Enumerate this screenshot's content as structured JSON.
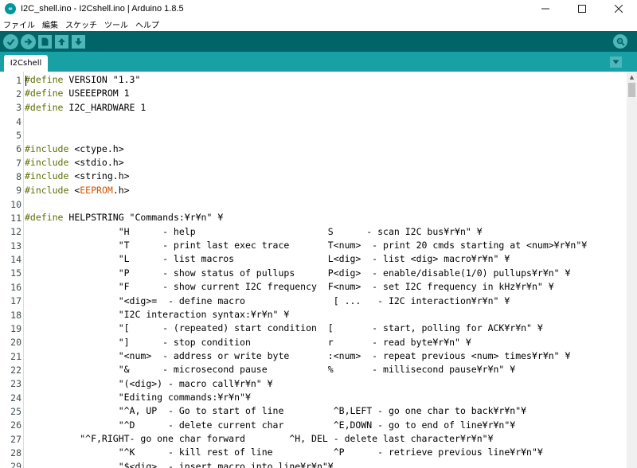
{
  "window": {
    "title": "I2C_shell.ino - I2Cshell.ino | Arduino 1.8.5",
    "app_icon": "arduino-logo-icon",
    "controls": [
      "minimize",
      "maximize",
      "close"
    ]
  },
  "menu": {
    "items": [
      "ファイル",
      "編集",
      "スケッチ",
      "ツール",
      "ヘルプ"
    ]
  },
  "toolbar": {
    "buttons": [
      "verify-icon",
      "upload-icon",
      "new-icon",
      "open-icon",
      "save-icon"
    ],
    "right_button": "serial-monitor-icon"
  },
  "tabs": {
    "active": "I2Cshell",
    "menu_icon": "tab-menu-arrow-icon"
  },
  "colors": {
    "toolbar_bg": "#006468",
    "tabbar_bg": "#17a1a5",
    "button_bg": "#4db7bb",
    "preprocessor": "#5e6d03",
    "library_keyword": "#d35400",
    "line_number": "#434f54"
  },
  "editor": {
    "line_numbers": [
      "1",
      "2",
      "3",
      "4",
      "5",
      "6",
      "7",
      "8",
      "9",
      "10",
      "11",
      "12",
      "13",
      "14",
      "15",
      "16",
      "17",
      "18",
      "19",
      "20",
      "21",
      "22",
      "23",
      "24",
      "25",
      "26",
      "27",
      "28",
      "29"
    ],
    "lines": [
      {
        "pre": "#define",
        "text": " VERSION \"1.3\""
      },
      {
        "pre": "#define",
        "text": " USEEEPROM 1"
      },
      {
        "pre": "#define",
        "text": " I2C_HARDWARE 1"
      },
      {
        "pre": "",
        "text": ""
      },
      {
        "pre": "",
        "text": ""
      },
      {
        "pre": "#include",
        "text": " <ctype.h>"
      },
      {
        "pre": "#include",
        "text": " <stdio.h>"
      },
      {
        "pre": "#include",
        "text": " <string.h>"
      },
      {
        "pre": "#include",
        "text": " <",
        "lib": "EEPROM",
        "after": ".h>"
      },
      {
        "pre": "",
        "text": ""
      },
      {
        "pre": "#define",
        "text": " HELPSTRING \"Commands:¥r¥n\" ¥"
      },
      {
        "pre": "",
        "text": "                 \"H      - help                        S      - scan I2C bus¥r¥n\" ¥"
      },
      {
        "pre": "",
        "text": "                 \"T      - print last exec trace       T<num>  - print 20 cmds starting at <num>¥r¥n\"¥"
      },
      {
        "pre": "",
        "text": "                 \"L      - list macros                 L<dig>  - list <dig> macro¥r¥n\" ¥"
      },
      {
        "pre": "",
        "text": "                 \"P      - show status of pullups      P<dig>  - enable/disable(1/0) pullups¥r¥n\" ¥"
      },
      {
        "pre": "",
        "text": "                 \"F      - show current I2C frequency  F<num>  - set I2C frequency in kHz¥r¥n\" ¥"
      },
      {
        "pre": "",
        "text": "                 \"<dig>=  - define macro                [ ...   - I2C interaction¥r¥n\" ¥"
      },
      {
        "pre": "",
        "text": "                 \"I2C interaction syntax:¥r¥n\" ¥"
      },
      {
        "pre": "",
        "text": "                 \"[      - (repeated) start condition  [       - start, polling for ACK¥r¥n\" ¥"
      },
      {
        "pre": "",
        "text": "                 \"]      - stop condition              r       - read byte¥r¥n\" ¥"
      },
      {
        "pre": "",
        "text": "                 \"<num>  - address or write byte       :<num>  - repeat previous <num> times¥r¥n\" ¥"
      },
      {
        "pre": "",
        "text": "                 \"&      - microsecond pause           %       - millisecond pause¥r¥n\" ¥"
      },
      {
        "pre": "",
        "text": "                 \"(<dig>) - macro call¥r¥n\" ¥"
      },
      {
        "pre": "",
        "text": "                 \"Editing commands:¥r¥n\"¥"
      },
      {
        "pre": "",
        "text": "                 \"^A, UP  - Go to start of line         ^B,LEFT - go one char to back¥r¥n\"¥"
      },
      {
        "pre": "",
        "text": "                 \"^D      - delete current char         ^E,DOWN - go to end of line¥r¥n\"¥"
      },
      {
        "pre": "",
        "text": "          \"^F,RIGHT- go one char forward        ^H, DEL - delete last character¥r¥n\"¥"
      },
      {
        "pre": "",
        "text": "                 \"^K      - kill rest of line           ^P      - retrieve previous line¥r¥n\"¥"
      },
      {
        "pre": "",
        "text": "                 \"$<dig>  - insert macro into line¥r¥n\"¥"
      }
    ]
  }
}
